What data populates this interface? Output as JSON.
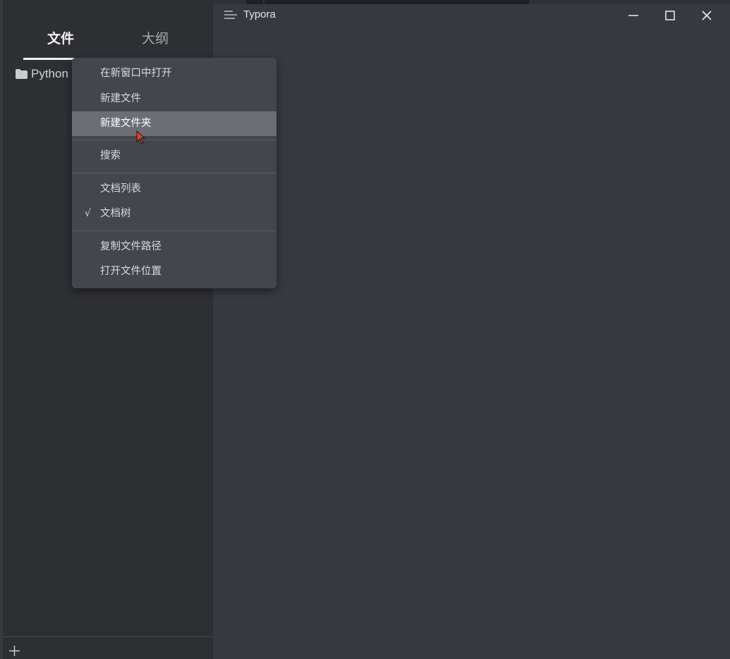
{
  "window": {
    "title": "Typora"
  },
  "sidebar": {
    "tabs": [
      {
        "label": "文件",
        "active": true
      },
      {
        "label": "大纲",
        "active": false
      }
    ],
    "tree": [
      {
        "label": "Python",
        "icon": "folder-icon"
      }
    ],
    "footer_icon": "add-icon"
  },
  "context_menu": {
    "items": [
      {
        "label": "在新窗口中打开"
      },
      {
        "label": "新建文件"
      },
      {
        "label": "新建文件夹",
        "highlighted": true
      },
      {
        "label": "搜索"
      },
      {
        "label": "文档列表"
      },
      {
        "label": "文档树",
        "checked": true,
        "check_mark": "√"
      },
      {
        "label": "复制文件路径"
      },
      {
        "label": "打开文件位置"
      }
    ]
  },
  "colors": {
    "editor_bg": "#363a40",
    "sidebar_bg": "#2e2f33",
    "menu_bg": "#43464c",
    "menu_highlight": "#6c6e76",
    "cursor": "#e8402a"
  }
}
